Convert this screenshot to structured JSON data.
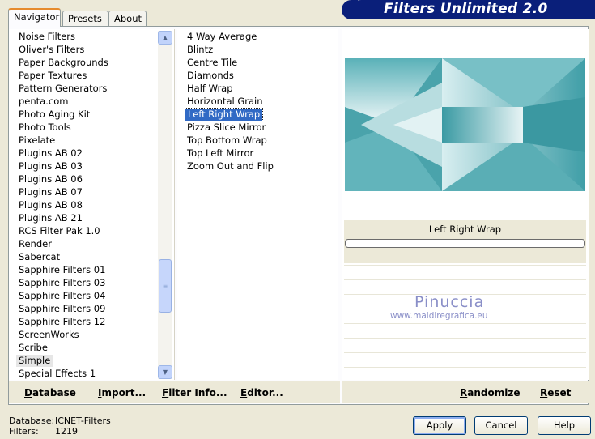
{
  "app": {
    "title": "Filters Unlimited 2.0"
  },
  "tabs": [
    {
      "label": "Navigator",
      "active": true
    },
    {
      "label": "Presets",
      "active": false
    },
    {
      "label": "About",
      "active": false
    }
  ],
  "categories": [
    "Noise Filters",
    "Oliver's Filters",
    "Paper Backgrounds",
    "Paper Textures",
    "Pattern Generators",
    "penta.com",
    "Photo Aging Kit",
    "Photo Tools",
    "Pixelate",
    "Plugins AB 02",
    "Plugins AB 03",
    "Plugins AB 06",
    "Plugins AB 07",
    "Plugins AB 08",
    "Plugins AB 21",
    "RCS Filter Pak 1.0",
    "Render",
    "Sabercat",
    "Sapphire Filters 01",
    "Sapphire Filters 03",
    "Sapphire Filters 04",
    "Sapphire Filters 09",
    "Sapphire Filters 12",
    "ScreenWorks",
    "Scribe",
    "Simple",
    "Special Effects 1"
  ],
  "selected_category": "Simple",
  "filters": [
    "4 Way Average",
    "Blintz",
    "Centre Tile",
    "Diamonds",
    "Half Wrap",
    "Horizontal Grain",
    "Left Right Wrap",
    "Pizza Slice Mirror",
    "Top Bottom Wrap",
    "Top Left Mirror",
    "Zoom Out and Flip"
  ],
  "selected_filter": "Left Right Wrap",
  "preview": {
    "filter_name": "Left Right Wrap",
    "watermark_name": "Pinuccia",
    "watermark_url": "www.maidiregrafica.eu"
  },
  "toolbar": {
    "database": "Database",
    "import": "Import...",
    "filter_info": "Filter Info...",
    "editor": "Editor...",
    "randomize": "Randomize",
    "reset": "Reset"
  },
  "footer": {
    "database_label": "Database:",
    "database_value": "ICNET-Filters",
    "filters_label": "Filters:",
    "filters_value": "1219",
    "apply": "Apply",
    "cancel": "Cancel",
    "help": "Help"
  },
  "colors": {
    "banner": "#0a1f7a",
    "selection": "#316ac5",
    "preview_teal": "#4aa3ab"
  }
}
